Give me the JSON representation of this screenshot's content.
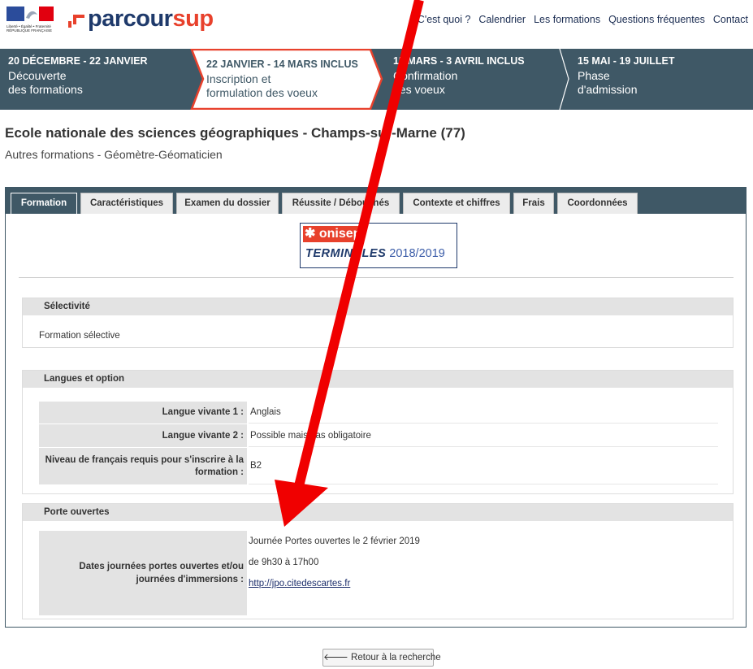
{
  "header": {
    "gov_text": "Liberté • Égalité • Fraternité RÉPUBLIQUE FRANÇAISE",
    "logo_part1": "parcour",
    "logo_part2": "sup",
    "nav": [
      "C'est quoi ?",
      "Calendrier",
      "Les formations",
      "Questions fréquentes",
      "Contact"
    ]
  },
  "timeline": {
    "steps": [
      {
        "dates": "20 DÉCEMBRE - 22 JANVIER",
        "label_line1": "Découverte",
        "label_line2": "des formations"
      },
      {
        "dates": "22 JANVIER - 14 MARS INCLUS",
        "label_line1": "Inscription et",
        "label_line2": "formulation des voeux"
      },
      {
        "dates": "15 MARS - 3 AVRIL INCLUS",
        "label_line1": "Confirmation",
        "label_line2": "des voeux"
      },
      {
        "dates": "15 MAI - 19 JUILLET",
        "label_line1": "Phase",
        "label_line2": "d'admission"
      }
    ],
    "active_color": "#e8412c"
  },
  "page": {
    "title": "Ecole nationale des sciences géographiques - Champs-sur-Marne (77)",
    "subtitle": "Autres formations - Géomètre-Géomaticien"
  },
  "tabs": [
    "Formation",
    "Caractéristiques",
    "Examen du dossier",
    "Réussite / Débouchés",
    "Contexte et chiffres",
    "Frais",
    "Coordonnées"
  ],
  "onisep": {
    "brand": "onisep",
    "edition_word": "TERMINALES",
    "edition_year": "2018/2019"
  },
  "selectivite": {
    "heading": "Sélectivité",
    "text": "Formation sélective"
  },
  "langues": {
    "heading": "Langues et option",
    "rows": [
      {
        "label": "Langue vivante 1 :",
        "value": "Anglais"
      },
      {
        "label": "Langue vivante 2 :",
        "value": "Possible mais pas obligatoire"
      },
      {
        "label": "Niveau de français requis pour s'inscrire à la formation :",
        "value": "B2"
      }
    ]
  },
  "portes": {
    "heading": "Porte ouvertes",
    "label": "Dates journées portes ouvertes et/ou journées d'immersions :",
    "line1": "Journée Portes ouvertes le 2 février 2019",
    "line2": "de 9h30 à 17h00",
    "link": "http://jpo.citedescartes.fr"
  },
  "back_button": "Retour à la recherche",
  "annotation_color": "#f00000"
}
